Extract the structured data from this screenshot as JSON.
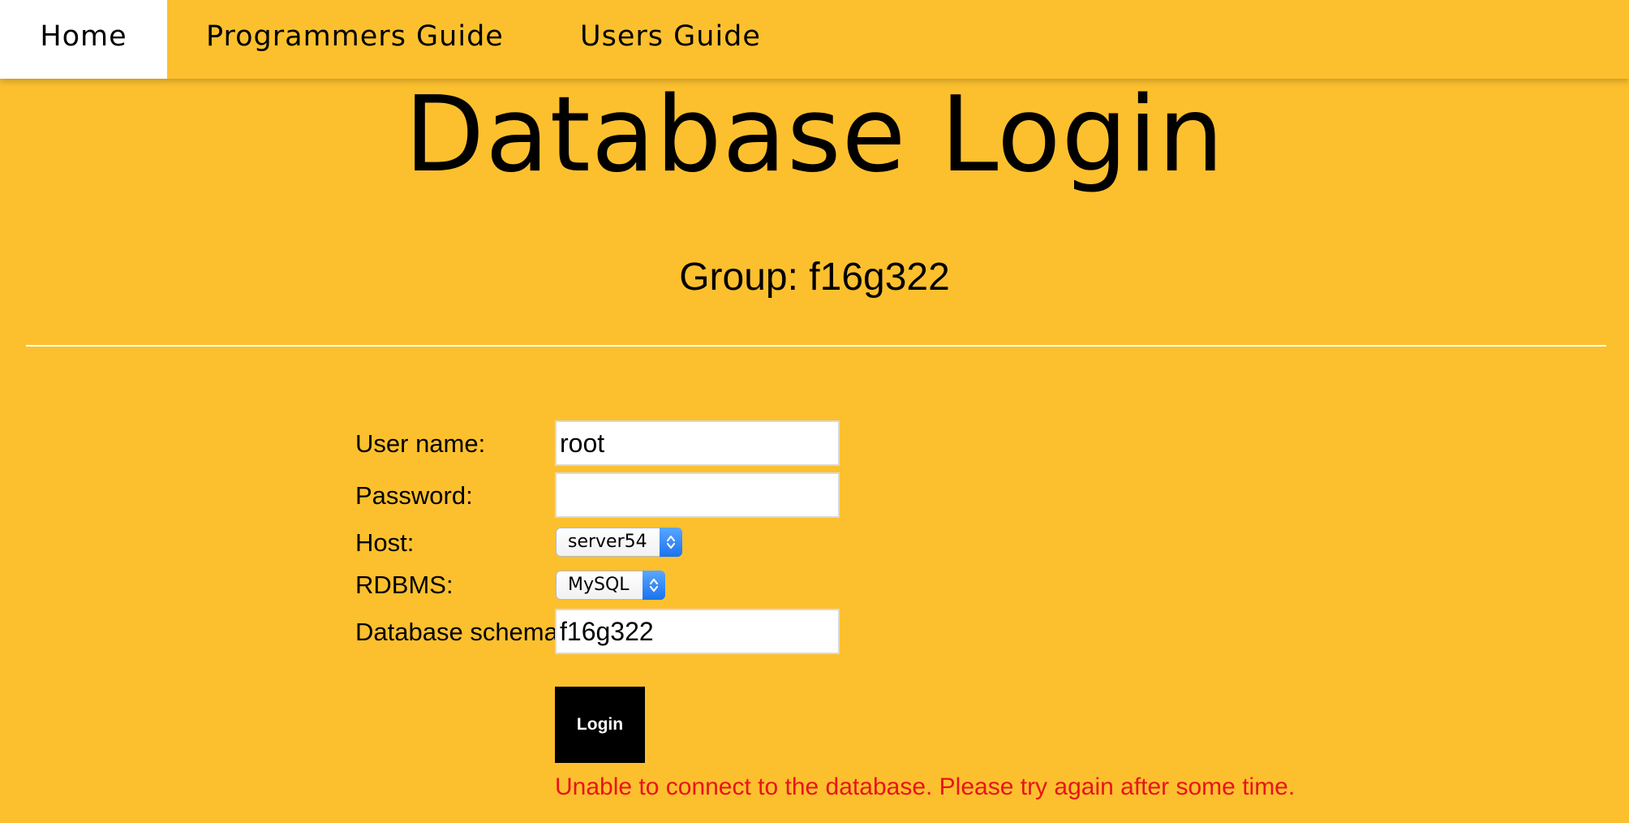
{
  "nav": {
    "tabs": [
      {
        "label": "Home",
        "active": true
      },
      {
        "label": "Programmers Guide",
        "active": false
      },
      {
        "label": "Users Guide",
        "active": false
      }
    ]
  },
  "page": {
    "title": "Database Login",
    "group": "Group: f16g322"
  },
  "form": {
    "username": {
      "label": "User name:",
      "value": "root"
    },
    "password": {
      "label": "Password:",
      "value": ""
    },
    "host": {
      "label": "Host:",
      "selected": "server54"
    },
    "rdbms": {
      "label": "RDBMS:",
      "selected": "MySQL"
    },
    "schema": {
      "label": "Database schema:",
      "value": "f16g322"
    },
    "login_label": "Login",
    "error": "Unable to connect to the database. Please try again after some time."
  },
  "colors": {
    "background": "#fcc02e",
    "error": "#e8141b",
    "button": "#000000",
    "select_arrow": "#1a73f0"
  }
}
